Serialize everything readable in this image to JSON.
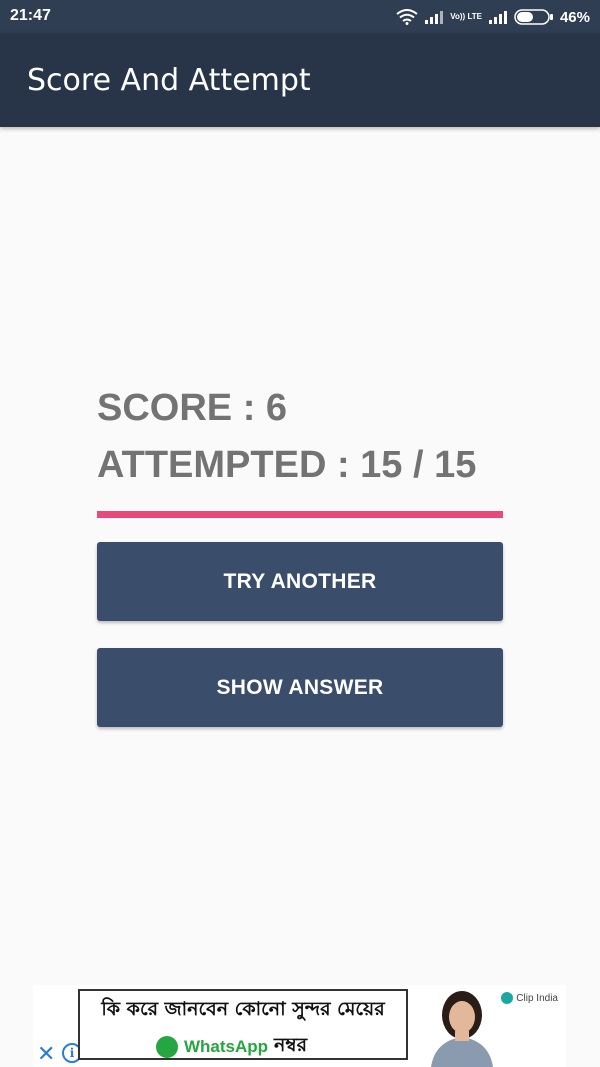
{
  "status_bar": {
    "time": "21:47",
    "network_label": "Vo)) LTE",
    "battery_percent": "46%",
    "icons": [
      "wifi-icon",
      "signal-icon",
      "volte-icon",
      "signal-icon",
      "battery-icon"
    ]
  },
  "app_bar": {
    "title": "Score And Attempt"
  },
  "result": {
    "score_line": "SCORE : 6",
    "attempted_line": "ATTEMPTED : 15 / 15"
  },
  "actions": {
    "try_another_label": "TRY ANOTHER",
    "show_answer_label": "SHOW ANSWER"
  },
  "ad": {
    "headline": "কি করে জানবেন কোনো সুন্দর মেয়ের",
    "whatsapp_label": "WhatsApp",
    "number_word": "নম্বর",
    "brand": "Clip India",
    "close_symbol": "✕",
    "info_symbol": "i"
  },
  "colors": {
    "status_bar": "#2f3e52",
    "app_bar": "#283548",
    "button": "#3a4d6a",
    "accent_divider": "#e8497a",
    "score_text": "#737373",
    "background": "#fafafa"
  }
}
